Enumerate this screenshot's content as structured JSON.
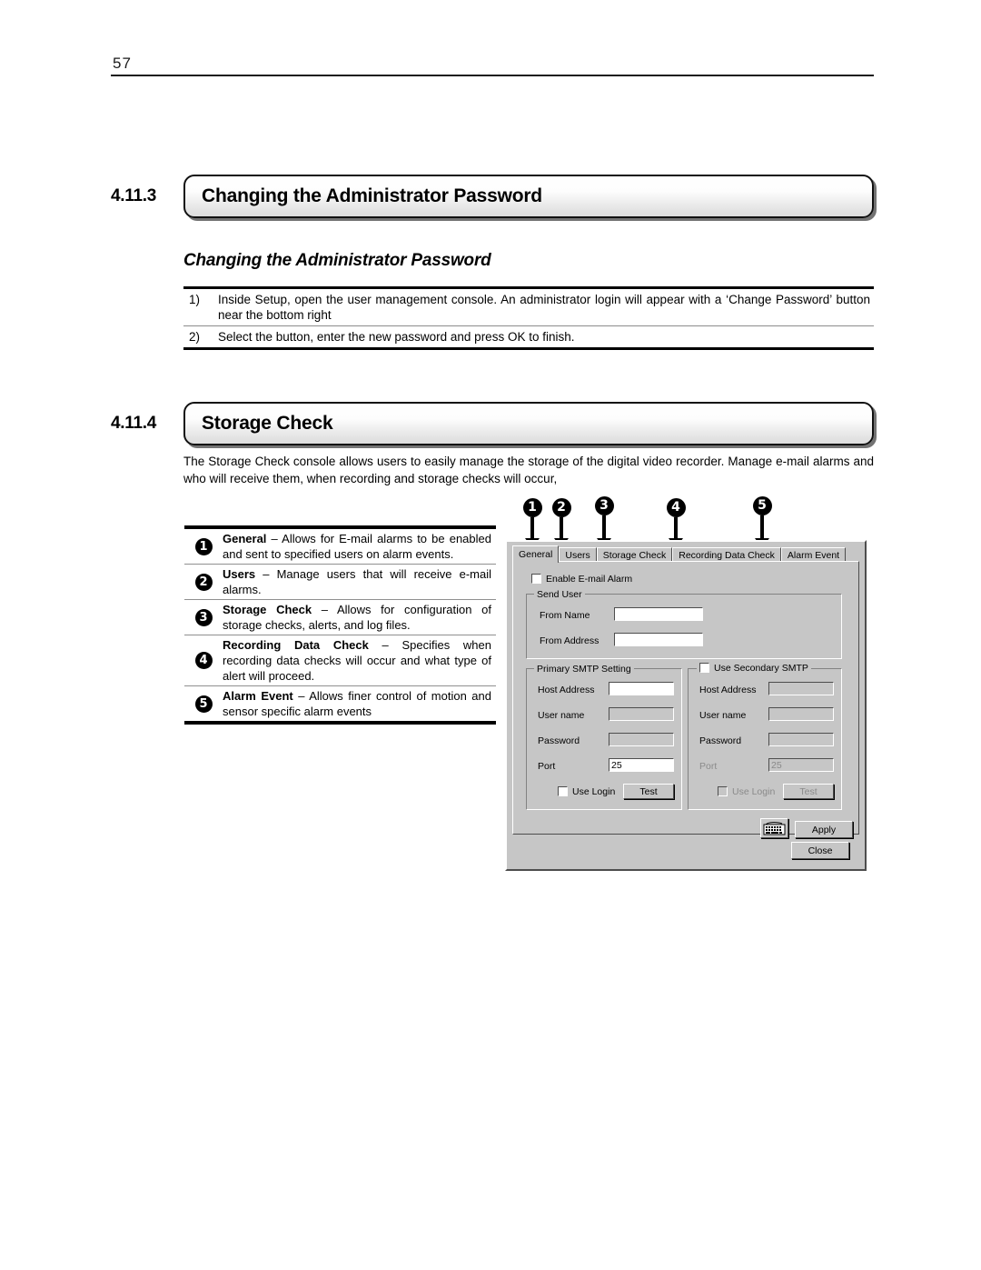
{
  "page": {
    "number": "57"
  },
  "sections": [
    {
      "number": "4.11.3",
      "title": "Changing the Administrator Password",
      "sub_heading": "Changing the Administrator Password",
      "steps": [
        {
          "num": "1)",
          "text": "Inside Setup, open the user management console. An administrator login will appear with a ‘Change Password’ button near the bottom right"
        },
        {
          "num": "2)",
          "text": "Select the button, enter the new password and press OK to finish."
        }
      ]
    },
    {
      "number": "4.11.4",
      "title": "Storage Check",
      "paragraph": "The Storage Check console allows users to easily manage the storage of the digital video recorder. Manage e-mail alarms and who will receive them, when recording and storage checks will occur,"
    }
  ],
  "legend": [
    {
      "num": "1",
      "term": "General",
      "desc": " – Allows for E-mail alarms to be enabled and sent to specified users on alarm events."
    },
    {
      "num": "2",
      "term": "Users",
      "desc": " – Manage users that will receive e-mail alarms."
    },
    {
      "num": "3",
      "term": "Storage Check",
      "desc": " – Allows for configuration of storage checks, alerts, and log files."
    },
    {
      "num": "4",
      "term": "Recording Data Check",
      "desc": " – Specifies when recording data checks will occur and what type of alert will proceed."
    },
    {
      "num": "5",
      "term": "Alarm Event",
      "desc": " – Allows finer control of motion and sensor specific alarm events"
    }
  ],
  "markers": [
    {
      "num": "1"
    },
    {
      "num": "2"
    },
    {
      "num": "3"
    },
    {
      "num": "4"
    },
    {
      "num": "5"
    }
  ],
  "dialog": {
    "tabs": [
      {
        "label": "General"
      },
      {
        "label": "Users"
      },
      {
        "label": "Storage Check"
      },
      {
        "label": "Recording Data Check"
      },
      {
        "label": "Alarm Event"
      }
    ],
    "enable_email_alarm": "Enable E-mail Alarm",
    "send_user": {
      "title": "Send User",
      "from_name_label": "From Name",
      "from_name_value": "",
      "from_address_label": "From Address",
      "from_address_value": ""
    },
    "primary_smtp": {
      "title": "Primary SMTP Setting",
      "host_label": "Host Address",
      "host_value": "",
      "user_label": "User name",
      "user_value": "",
      "password_label": "Password",
      "password_value": "",
      "port_label": "Port",
      "port_value": "25",
      "use_login_label": "Use Login",
      "test_label": "Test"
    },
    "secondary_smtp": {
      "title": "Use Secondary SMTP",
      "host_label": "Host Address",
      "host_value": "",
      "user_label": "User name",
      "user_value": "",
      "password_label": "Password",
      "password_value": "",
      "port_label": "Port",
      "port_value": "25",
      "use_login_label": "Use Login",
      "test_label": "Test"
    },
    "keyboard_icon": "on-screen-keyboard-icon",
    "apply_label": "Apply",
    "close_label": "Close"
  }
}
